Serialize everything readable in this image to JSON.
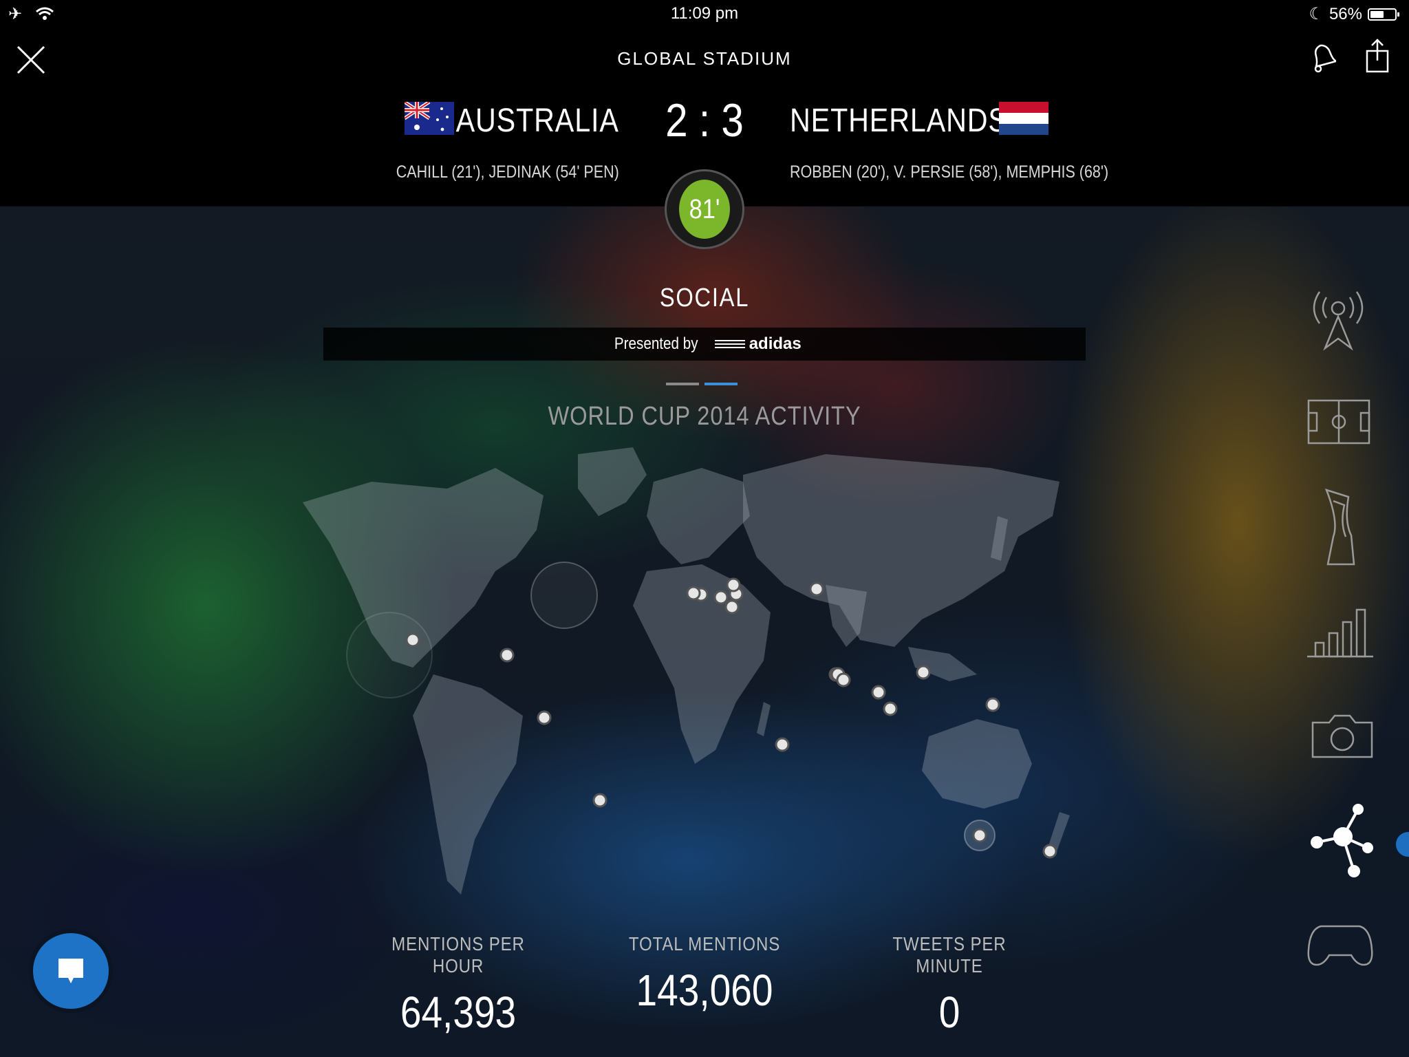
{
  "status_bar": {
    "time": "11:09 pm",
    "battery": "56%",
    "battery_level": 0.56,
    "icons": [
      "airplane-icon",
      "wifi-icon",
      "moon-icon",
      "battery-icon"
    ]
  },
  "header": {
    "title": "GLOBAL STADIUM",
    "home_team": "AUSTRALIA",
    "away_team": "NETHERLANDS",
    "score": "2 : 3",
    "home_scorers": "CAHILL (21'), JEDINAK (54' PEN)",
    "away_scorers": "ROBBEN (20'), V. PERSIE (58'), MEMPHIS (68')",
    "match_minute": "81'",
    "clock_color": "#7cb62a"
  },
  "section": {
    "title": "SOCIAL",
    "presented_by": "Presented by",
    "sponsor": "adidas",
    "subtitle": "WORLD CUP 2014 ACTIVITY"
  },
  "side_nav": [
    {
      "icon": "broadcast-icon",
      "active": false
    },
    {
      "icon": "pitch-icon",
      "active": false
    },
    {
      "icon": "trophy-icon",
      "active": false
    },
    {
      "icon": "bar-chart-icon",
      "active": false
    },
    {
      "icon": "camera-icon",
      "active": false
    },
    {
      "icon": "social-network-icon",
      "active": true
    },
    {
      "icon": "gamepad-icon",
      "active": false
    }
  ],
  "stats": [
    {
      "label": "MENTIONS PER HOUR",
      "value": "64,393"
    },
    {
      "label": "TOTAL MENTIONS",
      "value": "143,060"
    },
    {
      "label": "TWEETS PER MINUTE",
      "value": "0"
    }
  ],
  "colors": {
    "accent_blue": "#1f73c6",
    "pager_active": "#3f8fd8"
  }
}
